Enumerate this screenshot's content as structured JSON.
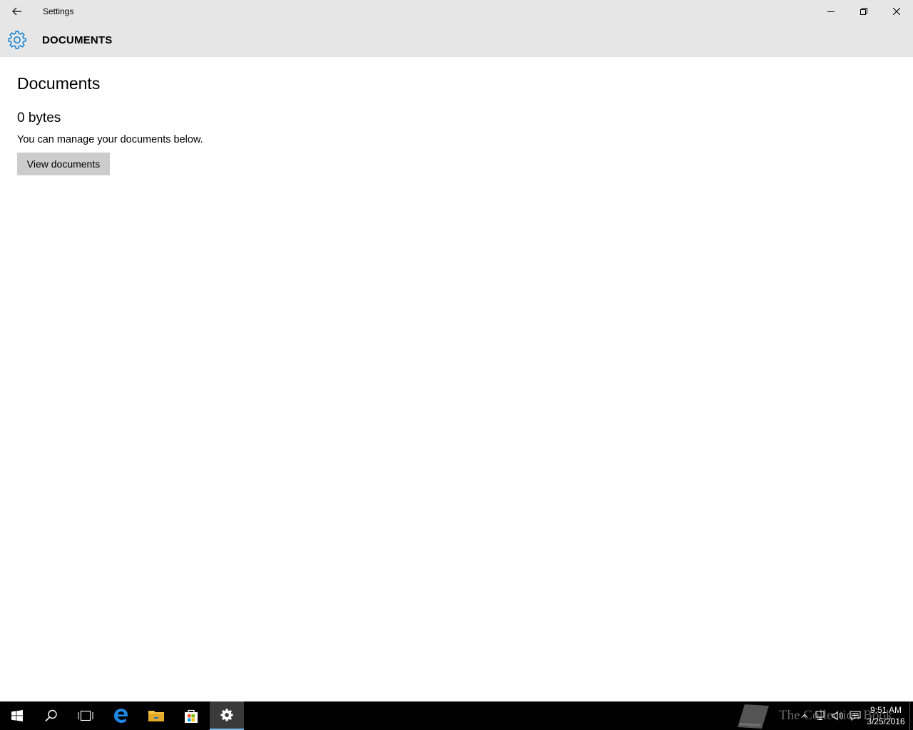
{
  "window": {
    "title": "Settings",
    "controls": {
      "back": "back-arrow-icon",
      "minimize": "minimize-icon",
      "maximize": "restore-icon",
      "close": "close-icon"
    }
  },
  "header": {
    "icon": "gear-icon",
    "title": "DOCUMENTS"
  },
  "main": {
    "title": "Documents",
    "size": "0 bytes",
    "description": "You can manage your documents below.",
    "view_button_label": "View documents"
  },
  "taskbar": {
    "items": [
      {
        "name": "start",
        "icon": "windows-logo-icon"
      },
      {
        "name": "search",
        "icon": "search-icon"
      },
      {
        "name": "task-view",
        "icon": "task-view-icon"
      },
      {
        "name": "edge",
        "icon": "edge-icon"
      },
      {
        "name": "file-explorer",
        "icon": "folder-icon"
      },
      {
        "name": "store",
        "icon": "store-icon"
      },
      {
        "name": "settings",
        "icon": "gear-icon",
        "active": true
      }
    ],
    "watermark": "The Collection Book",
    "clock": {
      "time": "9:51 AM",
      "date": "3/25/2016"
    }
  },
  "colors": {
    "chrome_bg": "#e6e6e6",
    "accent": "#0078d7",
    "button_bg": "#cccccc",
    "taskbar_bg": "#000000",
    "active_indicator": "#76b9ed"
  }
}
